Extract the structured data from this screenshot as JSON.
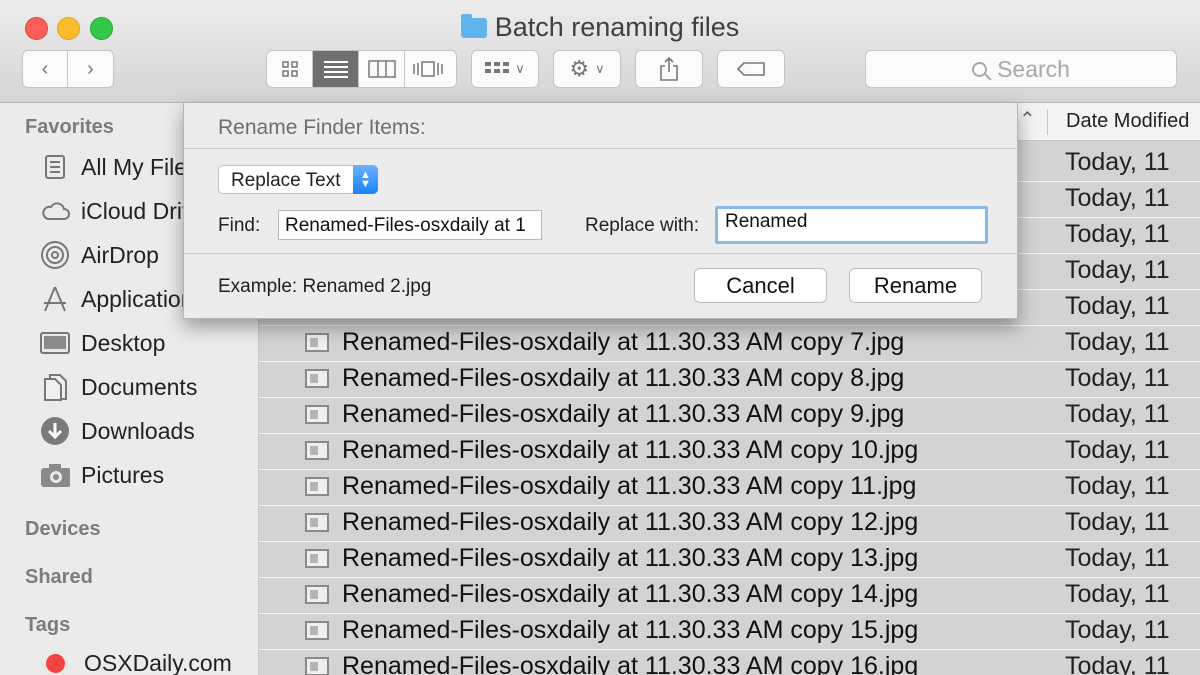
{
  "window": {
    "title": "Batch renaming files",
    "search_placeholder": "Search"
  },
  "toolbar": {
    "back_icon": "chevron-left-icon",
    "forward_icon": "chevron-right-icon",
    "view_modes": [
      "icon-view",
      "list-view",
      "column-view",
      "cover-flow-view"
    ],
    "active_view": "list-view",
    "arrange_icon": "arrange-grid-icon",
    "action_icon": "gear-icon",
    "share_icon": "share-icon",
    "tag_icon": "tag-icon"
  },
  "sidebar": {
    "favorites_heading": "Favorites",
    "items": [
      {
        "label": "All My Files",
        "icon": "all-my-files-icon"
      },
      {
        "label": "iCloud Drive",
        "icon": "cloud-icon"
      },
      {
        "label": "AirDrop",
        "icon": "airdrop-icon"
      },
      {
        "label": "Applications",
        "icon": "applications-icon"
      },
      {
        "label": "Desktop",
        "icon": "desktop-icon"
      },
      {
        "label": "Documents",
        "icon": "documents-icon"
      },
      {
        "label": "Downloads",
        "icon": "downloads-icon"
      },
      {
        "label": "Pictures",
        "icon": "camera-icon"
      }
    ],
    "devices_heading": "Devices",
    "shared_heading": "Shared",
    "tags_heading": "Tags",
    "tags": [
      {
        "label": "OSXDaily.com",
        "color": "#f2433e"
      }
    ]
  },
  "file_list": {
    "date_column": "Date Modified",
    "date_text": "Today, 11",
    "visible_rows": [
      {
        "name": "Renamed-Files-osxdaily at 11.30.33 AM copy 7.jpg",
        "date": "Today, 11"
      },
      {
        "name": "Renamed-Files-osxdaily at 11.30.33 AM copy 8.jpg",
        "date": "Today, 11"
      },
      {
        "name": "Renamed-Files-osxdaily at 11.30.33 AM copy 9.jpg",
        "date": "Today, 11"
      },
      {
        "name": "Renamed-Files-osxdaily at 11.30.33 AM copy 10.jpg",
        "date": "Today, 11"
      },
      {
        "name": "Renamed-Files-osxdaily at 11.30.33 AM copy 11.jpg",
        "date": "Today, 11"
      },
      {
        "name": "Renamed-Files-osxdaily at 11.30.33 AM copy 12.jpg",
        "date": "Today, 11"
      },
      {
        "name": "Renamed-Files-osxdaily at 11.30.33 AM copy 13.jpg",
        "date": "Today, 11"
      },
      {
        "name": "Renamed-Files-osxdaily at 11.30.33 AM copy 14.jpg",
        "date": "Today, 11"
      },
      {
        "name": "Renamed-Files-osxdaily at 11.30.33 AM copy 15.jpg",
        "date": "Today, 11"
      },
      {
        "name": "Renamed-Files-osxdaily at 11.30.33 AM copy 16.jpg",
        "date": "Today, 11"
      }
    ]
  },
  "dialog": {
    "title": "Rename Finder Items:",
    "mode": "Replace Text",
    "find_label": "Find:",
    "find_value": "Renamed-Files-osxdaily at 1",
    "replace_label": "Replace with:",
    "replace_value": "Renamed",
    "example": "Example: Renamed 2.jpg",
    "cancel": "Cancel",
    "rename": "Rename"
  },
  "colors": {
    "selection_bg": "#d3d3d3",
    "focus_ring": "#88b9eb",
    "stepper_blue": "#1a82fb"
  }
}
